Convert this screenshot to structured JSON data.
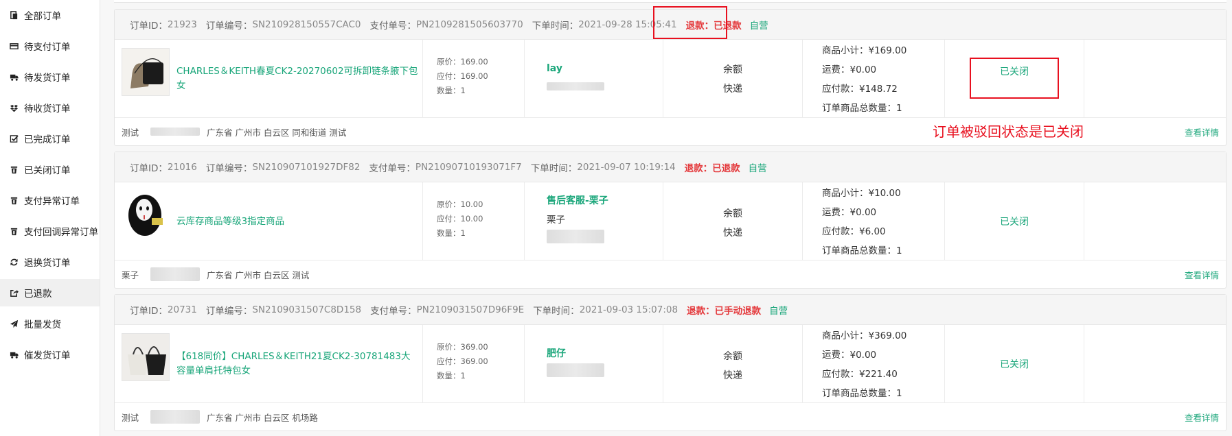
{
  "sidebar": {
    "items": [
      {
        "label": "全部订单",
        "icon": "file-icon"
      },
      {
        "label": "待支付订单",
        "icon": "card-icon"
      },
      {
        "label": "待发货订单",
        "icon": "truck-icon"
      },
      {
        "label": "待收货订单",
        "icon": "dropbox-icon"
      },
      {
        "label": "已完成订单",
        "icon": "check-square-icon"
      },
      {
        "label": "已关闭订单",
        "icon": "trash-icon"
      },
      {
        "label": "支付异常订单",
        "icon": "trash-icon"
      },
      {
        "label": "支付回调异常订单",
        "icon": "trash-icon"
      },
      {
        "label": "退换货订单",
        "icon": "refresh-icon"
      },
      {
        "label": "已退款",
        "icon": "share-icon"
      },
      {
        "label": "批量发货",
        "icon": "send-icon"
      },
      {
        "label": "催发货订单",
        "icon": "truck-icon"
      }
    ],
    "active_index": 9
  },
  "labels": {
    "order_id": "订单ID：",
    "order_no": "订单编号：",
    "pay_no": "支付单号：",
    "order_time": "下单时间：",
    "orig_price": "原价：",
    "due_price": "应付：",
    "qty": "数量：",
    "subtotal": "商品小计：",
    "freight": "运费：",
    "payable": "应付款：",
    "total_qty": "订单商品总数量：",
    "view_detail": "查看详情"
  },
  "orders": [
    {
      "id": "21923",
      "order_no": "SN210928150557CAC0",
      "pay_no": "PN2109281505603770",
      "time": "2021-09-28 15:05:41",
      "refund": "退款：已退款",
      "self": "自营",
      "product": "CHARLES＆KEITH春夏CK2-20270602可拆卸链条腋下包女",
      "orig_price": "169.00",
      "due_price": "169.00",
      "qty": "1",
      "buyer_name": "lay",
      "buyer_sub": "",
      "pay_method": "余额",
      "ship_method": "快递",
      "subtotal": "¥169.00",
      "freight": "¥0.00",
      "payable": "¥148.72",
      "total_qty": "1",
      "status": "已关闭",
      "addr_name": "测试",
      "address": "广东省 广州市 白云区 同和街道 测试"
    },
    {
      "id": "21016",
      "order_no": "SN210907101927DF82",
      "pay_no": "PN21090710193071F7",
      "time": "2021-09-07 10:19:14",
      "refund": "退款：已退款",
      "self": "自营",
      "product": "云库存商品等级3指定商品",
      "orig_price": "10.00",
      "due_price": "10.00",
      "qty": "1",
      "buyer_name": "售后客服-栗子",
      "buyer_sub": "栗子",
      "pay_method": "余额",
      "ship_method": "快递",
      "subtotal": "¥10.00",
      "freight": "¥0.00",
      "payable": "¥6.00",
      "total_qty": "1",
      "status": "已关闭",
      "addr_name": "栗子",
      "address": "广东省 广州市 白云区 测试"
    },
    {
      "id": "20731",
      "order_no": "SN2109031507C8D158",
      "pay_no": "PN2109031507D96F9E",
      "time": "2021-09-03 15:07:08",
      "refund": "退款：已手动退款",
      "self": "自营",
      "product": "【618同价】CHARLES＆KEITH21夏CK2-30781483大容量单肩托特包女",
      "orig_price": "369.00",
      "due_price": "369.00",
      "qty": "1",
      "buyer_name": "肥仔",
      "buyer_sub": "",
      "pay_method": "余额",
      "ship_method": "快递",
      "subtotal": "¥369.00",
      "freight": "¥0.00",
      "payable": "¥221.40",
      "total_qty": "1",
      "status": "已关闭",
      "addr_name": "测试",
      "address": "广东省 广州市 白云区 机场路"
    }
  ],
  "annotation": "订单被驳回状态是已关闭",
  "colors": {
    "accent": "#1aa67a",
    "refund": "#e4393c",
    "annotation": "#e8101f"
  }
}
